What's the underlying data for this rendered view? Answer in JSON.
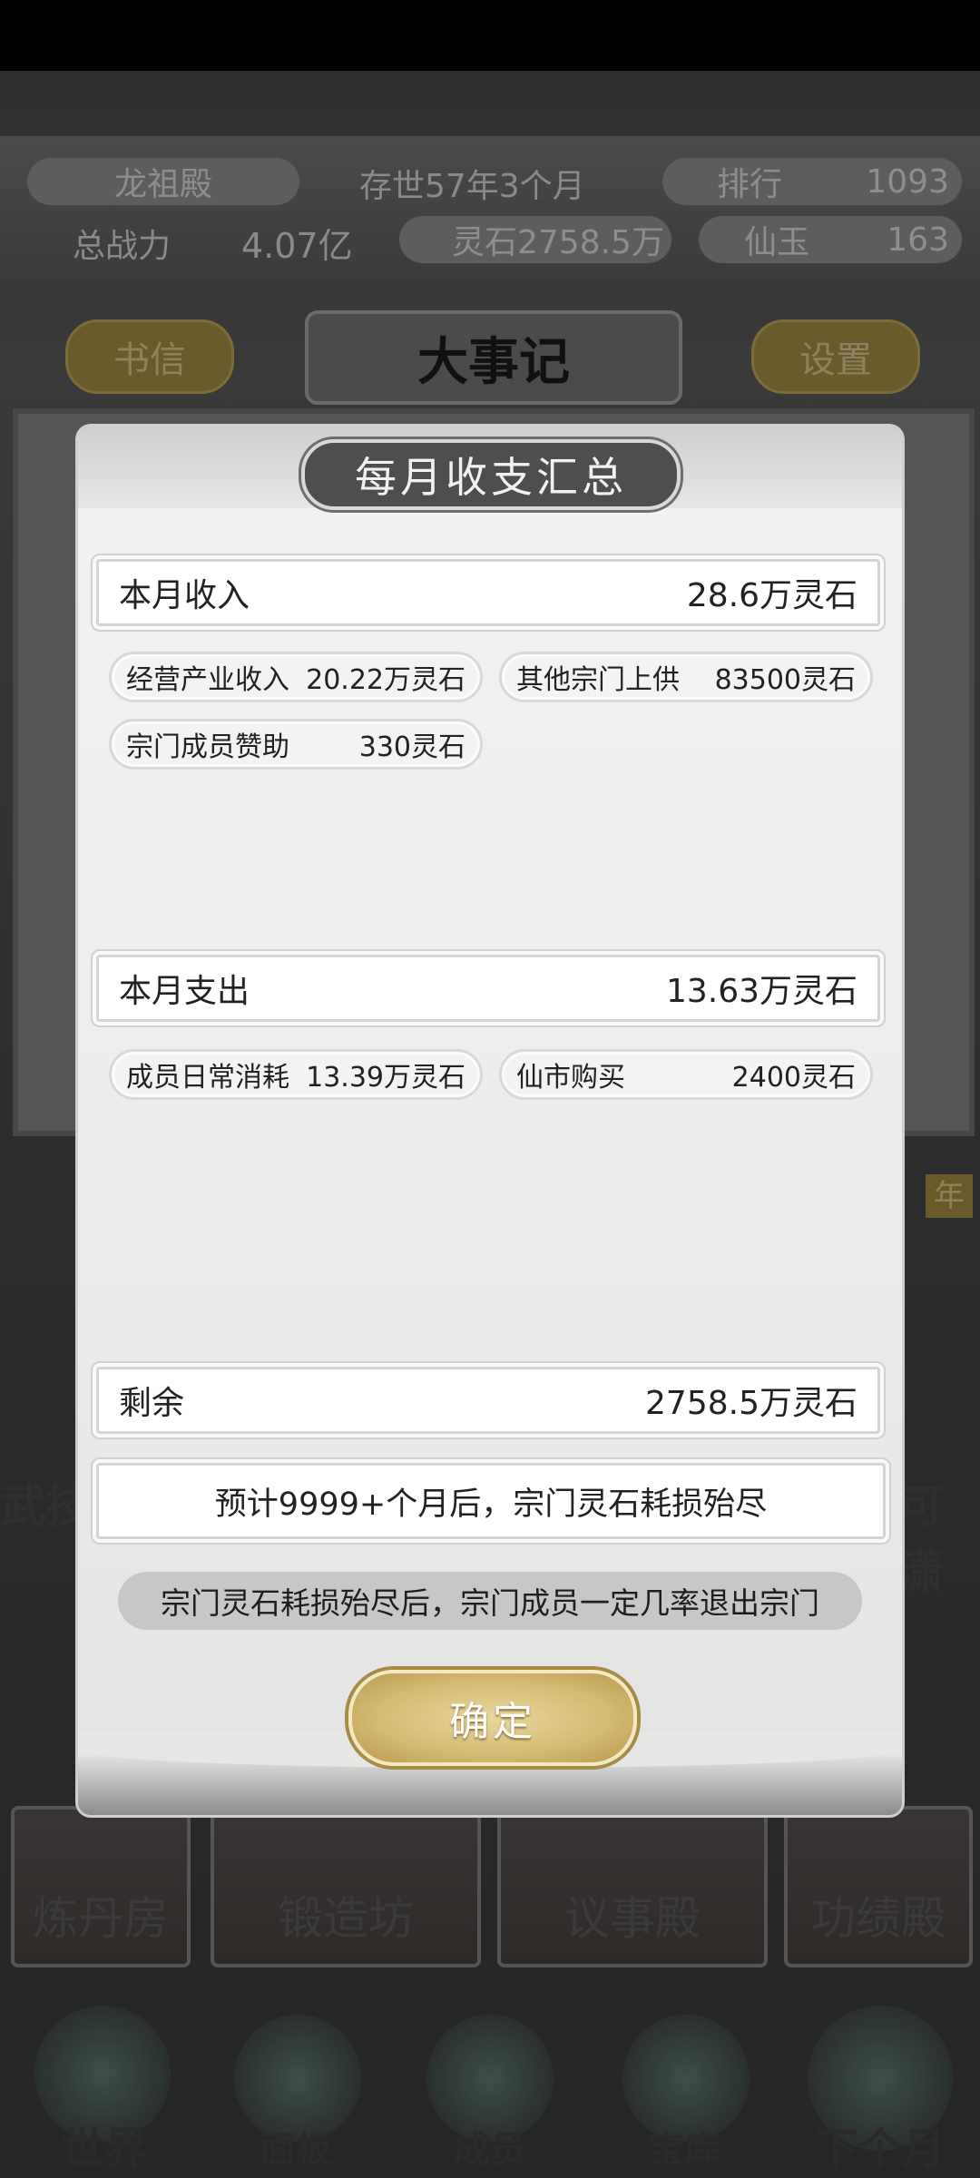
{
  "background": {
    "sect_name": "龙祖殿",
    "age": "存世57年3个月",
    "rank_label": "排行",
    "rank_value": "1093",
    "power_label": "总战力",
    "power_value": "4.07亿",
    "spirit_stones": "灵石2758.5万",
    "jade_label": "仙玉",
    "jade_value": "163",
    "btn_letters": "书信",
    "main_title": "大事记",
    "btn_settings": "设置",
    "side_left_label": "武技",
    "side_right_label": "可潇",
    "side_badge": "年",
    "buildings": [
      "炼丹房",
      "锻造坊",
      "议事殿",
      "功绩殿"
    ],
    "nav": [
      "世界",
      "面板",
      "成员",
      "宝库",
      "下个月"
    ]
  },
  "modal": {
    "title": "每月收支汇总",
    "income": {
      "label": "本月收入",
      "total": "28.6万灵石",
      "items": [
        {
          "label": "经营产业收入",
          "value": "20.22万灵石"
        },
        {
          "label": "其他宗门上供",
          "value": "83500灵石"
        },
        {
          "label": "宗门成员赞助",
          "value": "330灵石"
        }
      ]
    },
    "expense": {
      "label": "本月支出",
      "total": "13.63万灵石",
      "items": [
        {
          "label": "成员日常消耗",
          "value": "13.39万灵石"
        },
        {
          "label": "仙市购买",
          "value": "2400灵石"
        }
      ]
    },
    "remaining": {
      "label": "剩余",
      "value": "2758.5万灵石"
    },
    "forecast": "预计9999+个月后，宗门灵石耗损殆尽",
    "warning": "宗门灵石耗损殆尽后，宗门成员一定几率退出宗门",
    "confirm_label": "确定"
  }
}
